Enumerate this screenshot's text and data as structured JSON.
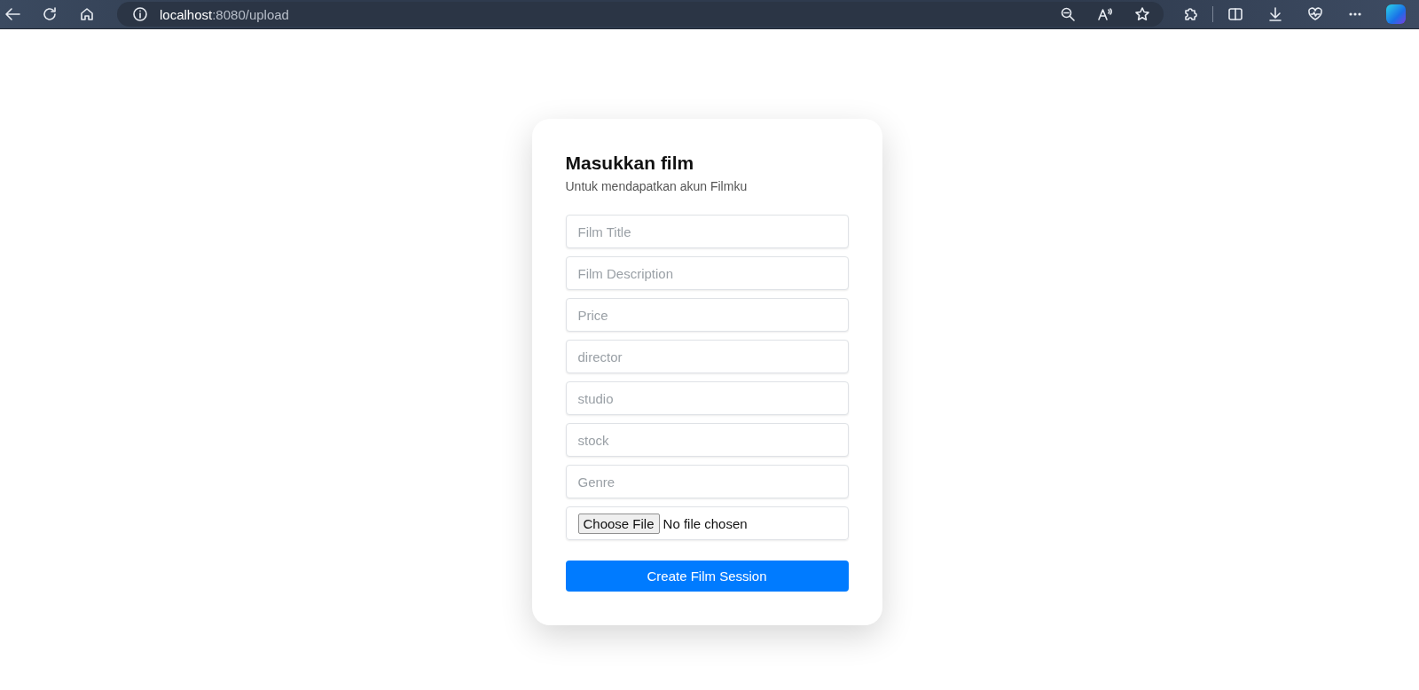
{
  "browser": {
    "url_host": "localhost",
    "url_path": ":8080/upload"
  },
  "form": {
    "title": "Masukkan film",
    "subtitle": "Untuk mendapatkan akun Filmku",
    "fields": [
      {
        "kind": "text",
        "placeholder": "Film Title"
      },
      {
        "kind": "text",
        "placeholder": "Film Description"
      },
      {
        "kind": "text",
        "placeholder": "Price"
      },
      {
        "kind": "text",
        "placeholder": "director"
      },
      {
        "kind": "text",
        "placeholder": "studio"
      },
      {
        "kind": "text",
        "placeholder": "stock"
      },
      {
        "kind": "text",
        "placeholder": "Genre"
      },
      {
        "kind": "file",
        "button": "Choose File",
        "status": "No file chosen"
      }
    ],
    "submit": "Create Film Session"
  }
}
